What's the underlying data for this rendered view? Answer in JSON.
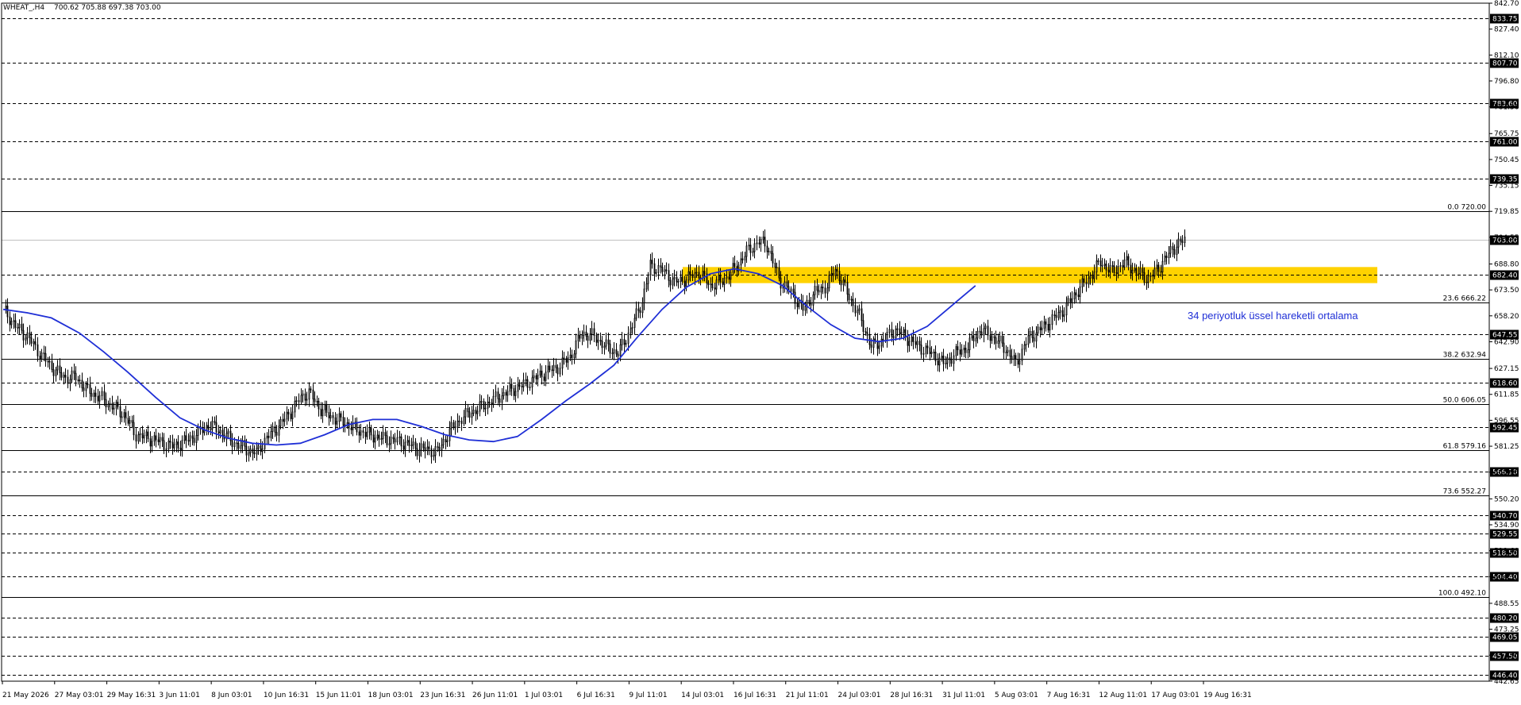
{
  "header": {
    "title": "WHEAT_,H4",
    "ohlc": "700.62 705.88 697.38 703.00"
  },
  "colors": {
    "candle_up": "#ffffff",
    "candle_down": "#000000",
    "wick": "#000000",
    "ema": "#1f2fd6",
    "zone": "#ffd200",
    "annotation_text": "#1f2fd6",
    "dashed_level": "#000000",
    "fib_line": "#000000"
  },
  "annotation": {
    "text": "34 periyotluk üssel hareketli ortalama"
  },
  "chart_data": {
    "type": "candlestick",
    "symbol": "WHEAT_",
    "timeframe": "H4",
    "ylim": [
      442.6,
      842.7
    ],
    "current_price": "703.00",
    "y_ticks": [
      "842.70",
      "827.40",
      "812.10",
      "796.80",
      "781.50",
      "765.75",
      "750.45",
      "735.15",
      "719.85",
      "704.55",
      "688.80",
      "673.50",
      "658.20",
      "642.90",
      "627.15",
      "611.85",
      "596.55",
      "581.25",
      "565.95",
      "550.20",
      "534.90",
      "519.60",
      "504.30",
      "488.55",
      "473.25",
      "457.95",
      "442.65"
    ],
    "x_labels": [
      "21 May 2026",
      "27 May 03:01",
      "29 May 16:31",
      "3 Jun 11:01",
      "8 Jun 03:01",
      "10 Jun 16:31",
      "15 Jun 11:01",
      "18 Jun 03:01",
      "23 Jun 16:31",
      "26 Jun 11:01",
      "1 Jul 03:01",
      "6 Jul 16:31",
      "9 Jul 11:01",
      "14 Jul 03:01",
      "16 Jul 16:31",
      "21 Jul 11:01",
      "24 Jul 03:01",
      "28 Jul 16:31",
      "31 Jul 11:01",
      "5 Aug 03:01",
      "7 Aug 16:31",
      "12 Aug 11:01",
      "17 Aug 03:01",
      "19 Aug 16:31"
    ],
    "horizontal_levels": [
      {
        "value": 833.75,
        "label": "833.75"
      },
      {
        "value": 807.7,
        "label": "807.70"
      },
      {
        "value": 783.6,
        "label": "783.60"
      },
      {
        "value": 761.0,
        "label": "761.00"
      },
      {
        "value": 739.35,
        "label": "739.35"
      },
      {
        "value": 682.4,
        "label": "682.40"
      },
      {
        "value": 647.55,
        "label": "647.55"
      },
      {
        "value": 618.6,
        "label": "618.60"
      },
      {
        "value": 592.45,
        "label": "592.45"
      },
      {
        "value": 566.1,
        "label": "566.10"
      },
      {
        "value": 540.7,
        "label": "540.70"
      },
      {
        "value": 529.55,
        "label": "529.55"
      },
      {
        "value": 518.5,
        "label": "518.50"
      },
      {
        "value": 504.4,
        "label": "504.40"
      },
      {
        "value": 480.2,
        "label": "480.20"
      },
      {
        "value": 469.05,
        "label": "469.05"
      },
      {
        "value": 457.5,
        "label": "457.50"
      },
      {
        "value": 446.4,
        "label": "446.40"
      }
    ],
    "fib_levels": [
      {
        "value": 720.0,
        "label": "0.0 720.00"
      },
      {
        "value": 666.22,
        "label": "23.6 666.22"
      },
      {
        "value": 632.94,
        "label": "38.2 632.94"
      },
      {
        "value": 606.05,
        "label": "50.0 606.05"
      },
      {
        "value": 579.16,
        "label": "61.8 579.16"
      },
      {
        "value": 552.27,
        "label": "73.6 552.27"
      },
      {
        "value": 492.1,
        "label": "100.0 492.10"
      }
    ],
    "resistance_zone": {
      "low": 677.5,
      "high": 687.0
    },
    "ema": {
      "period": 34,
      "points": [
        [
          0,
          662
        ],
        [
          12,
          660
        ],
        [
          24,
          657
        ],
        [
          38,
          648
        ],
        [
          50,
          637
        ],
        [
          62,
          625
        ],
        [
          76,
          610
        ],
        [
          88,
          598
        ],
        [
          100,
          591
        ],
        [
          112,
          586
        ],
        [
          124,
          583
        ],
        [
          136,
          582
        ],
        [
          148,
          583
        ],
        [
          160,
          588
        ],
        [
          172,
          594
        ],
        [
          184,
          597
        ],
        [
          196,
          597
        ],
        [
          208,
          593
        ],
        [
          220,
          588
        ],
        [
          232,
          585
        ],
        [
          244,
          584
        ],
        [
          256,
          587
        ],
        [
          268,
          597
        ],
        [
          280,
          608
        ],
        [
          292,
          618
        ],
        [
          304,
          629
        ],
        [
          316,
          646
        ],
        [
          328,
          662
        ],
        [
          340,
          675
        ],
        [
          352,
          683
        ],
        [
          364,
          686
        ],
        [
          376,
          683
        ],
        [
          388,
          676
        ],
        [
          400,
          664
        ],
        [
          412,
          653
        ],
        [
          424,
          645
        ],
        [
          436,
          643
        ],
        [
          448,
          645
        ],
        [
          460,
          652
        ],
        [
          472,
          664
        ],
        [
          484,
          676
        ]
      ]
    },
    "candle_points": [
      [
        0,
        662
      ],
      [
        6,
        652
      ],
      [
        12,
        646
      ],
      [
        18,
        636
      ],
      [
        24,
        628
      ],
      [
        30,
        622
      ],
      [
        36,
        622
      ],
      [
        42,
        614
      ],
      [
        48,
        610
      ],
      [
        54,
        605
      ],
      [
        60,
        600
      ],
      [
        66,
        588
      ],
      [
        72,
        586
      ],
      [
        78,
        584
      ],
      [
        84,
        581
      ],
      [
        90,
        584
      ],
      [
        96,
        588
      ],
      [
        102,
        594
      ],
      [
        108,
        590
      ],
      [
        114,
        584
      ],
      [
        120,
        580
      ],
      [
        126,
        577
      ],
      [
        130,
        585
      ],
      [
        136,
        592
      ],
      [
        142,
        600
      ],
      [
        148,
        610
      ],
      [
        152,
        613
      ],
      [
        158,
        603
      ],
      [
        164,
        598
      ],
      [
        170,
        595
      ],
      [
        176,
        591
      ],
      [
        182,
        588
      ],
      [
        188,
        586
      ],
      [
        194,
        585
      ],
      [
        200,
        583
      ],
      [
        206,
        580
      ],
      [
        212,
        579
      ],
      [
        216,
        578
      ],
      [
        222,
        590
      ],
      [
        228,
        598
      ],
      [
        234,
        602
      ],
      [
        240,
        606
      ],
      [
        246,
        610
      ],
      [
        252,
        614
      ],
      [
        258,
        617
      ],
      [
        264,
        621
      ],
      [
        270,
        625
      ],
      [
        276,
        628
      ],
      [
        282,
        634
      ],
      [
        288,
        648
      ],
      [
        294,
        646
      ],
      [
        300,
        640
      ],
      [
        306,
        636
      ],
      [
        312,
        650
      ],
      [
        318,
        667
      ],
      [
        322,
        688
      ],
      [
        328,
        685
      ],
      [
        334,
        678
      ],
      [
        340,
        680
      ],
      [
        346,
        684
      ],
      [
        352,
        676
      ],
      [
        358,
        679
      ],
      [
        364,
        686
      ],
      [
        370,
        696
      ],
      [
        376,
        702
      ],
      [
        380,
        700
      ],
      [
        386,
        680
      ],
      [
        392,
        672
      ],
      [
        398,
        662
      ],
      [
        404,
        672
      ],
      [
        410,
        676
      ],
      [
        414,
        686
      ],
      [
        420,
        672
      ],
      [
        426,
        658
      ],
      [
        432,
        640
      ],
      [
        438,
        644
      ],
      [
        444,
        650
      ],
      [
        450,
        645
      ],
      [
        456,
        640
      ],
      [
        462,
        636
      ],
      [
        468,
        630
      ],
      [
        474,
        636
      ],
      [
        480,
        640
      ],
      [
        486,
        650
      ],
      [
        492,
        646
      ],
      [
        498,
        640
      ],
      [
        504,
        630
      ],
      [
        510,
        645
      ],
      [
        516,
        650
      ],
      [
        522,
        656
      ],
      [
        528,
        662
      ],
      [
        534,
        672
      ],
      [
        540,
        680
      ],
      [
        546,
        690
      ],
      [
        552,
        684
      ],
      [
        558,
        690
      ],
      [
        564,
        684
      ],
      [
        570,
        680
      ],
      [
        576,
        688
      ],
      [
        582,
        698
      ],
      [
        588,
        703
      ]
    ],
    "x_total": 588
  }
}
